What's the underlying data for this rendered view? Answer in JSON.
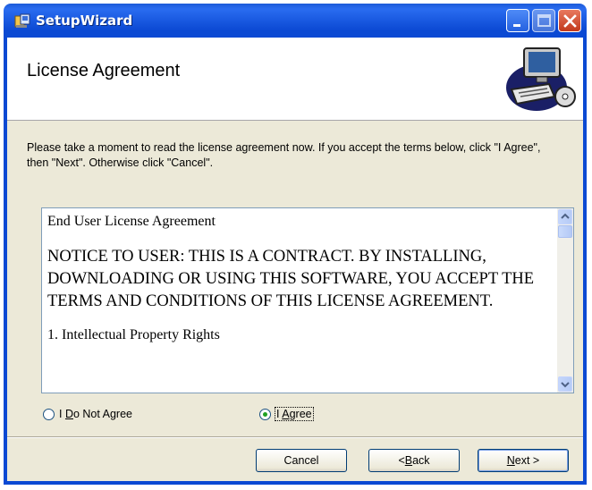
{
  "window": {
    "title": "SetupWizard"
  },
  "header": {
    "title": "License Agreement"
  },
  "instructions": {
    "text": "Please take a moment to read the license agreement now. If you accept the terms below, click \"I Agree\", then \"Next\". Otherwise click \"Cancel\"."
  },
  "license": {
    "title": "End User License Agreement",
    "notice": "NOTICE TO USER:  THIS IS A CONTRACT.  BY INSTALLING, DOWNLOADING OR USING THIS SOFTWARE, YOU ACCEPT THE TERMS AND CONDITIONS OF THIS LICENSE AGREEMENT.",
    "section1": "1.  Intellectual Property Rights"
  },
  "options": {
    "do_not_agree": {
      "prefix": "I ",
      "accel": "D",
      "rest": "o Not Agree",
      "selected": false
    },
    "agree": {
      "prefix": "I ",
      "accel": "A",
      "rest": "gree",
      "selected": true
    }
  },
  "buttons": {
    "cancel": "Cancel",
    "back_prefix": "< ",
    "back_accel": "B",
    "back_rest": "ack",
    "next_accel": "N",
    "next_rest": "ext >"
  },
  "colors": {
    "titlebar": "#0b49d3",
    "client_bg": "#ece9d8",
    "radio_dot": "#21a121"
  }
}
